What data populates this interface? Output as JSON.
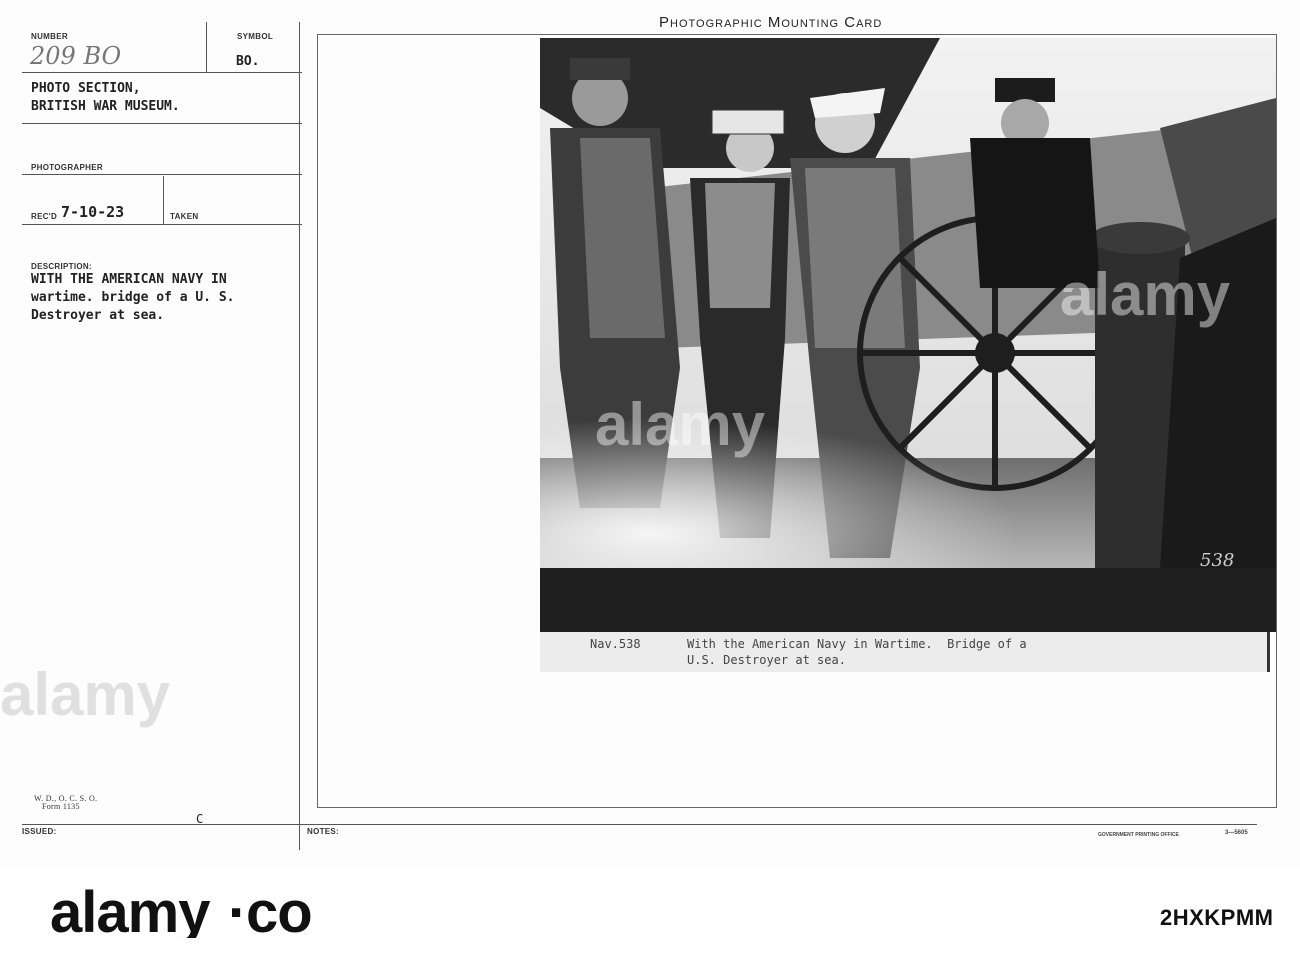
{
  "card_title": "Photographic Mounting Card",
  "fields": {
    "number_label": "NUMBER",
    "number_value": "209 BO",
    "symbol_label": "SYMBOL",
    "symbol_value": "BO.",
    "section_line1": "PHOTO SECTION,",
    "section_line2": "BRITISH WAR MUSEUM.",
    "photographer_label": "PHOTOGRAPHER",
    "recd_label": "REC'D",
    "recd_value": "7-10-23",
    "taken_label": "TAKEN",
    "description_label": "DESCRIPTION:",
    "description_lines": [
      "WITH THE AMERICAN NAVY IN",
      "wartime. bridge of a U. S.",
      "Destroyer at sea."
    ],
    "form_line1": "W. D., O. C. S. O.",
    "form_line2": "Form 1135",
    "issued_label": "ISSUED:",
    "issued_mark": "C",
    "notes_label": "NOTES:",
    "printing_office": "GOVERNMENT PRINTING OFFICE",
    "print_code": "3—5605"
  },
  "photo_caption": {
    "ref": "Nav.538",
    "line1": "With the American Navy in Wartime.  Bridge of a",
    "line2": "U.S. Destroyer at sea.",
    "corner_mark": "538"
  },
  "watermark": {
    "text": "alamy"
  },
  "footer": {
    "logo_text": "alamy",
    "image_id": "2HXKPMM"
  },
  "colors": {
    "card_bg": "#fdfdfd",
    "ink": "#222222",
    "photo_dark": "#1a1a1a",
    "caption_bg": "#ececec"
  }
}
